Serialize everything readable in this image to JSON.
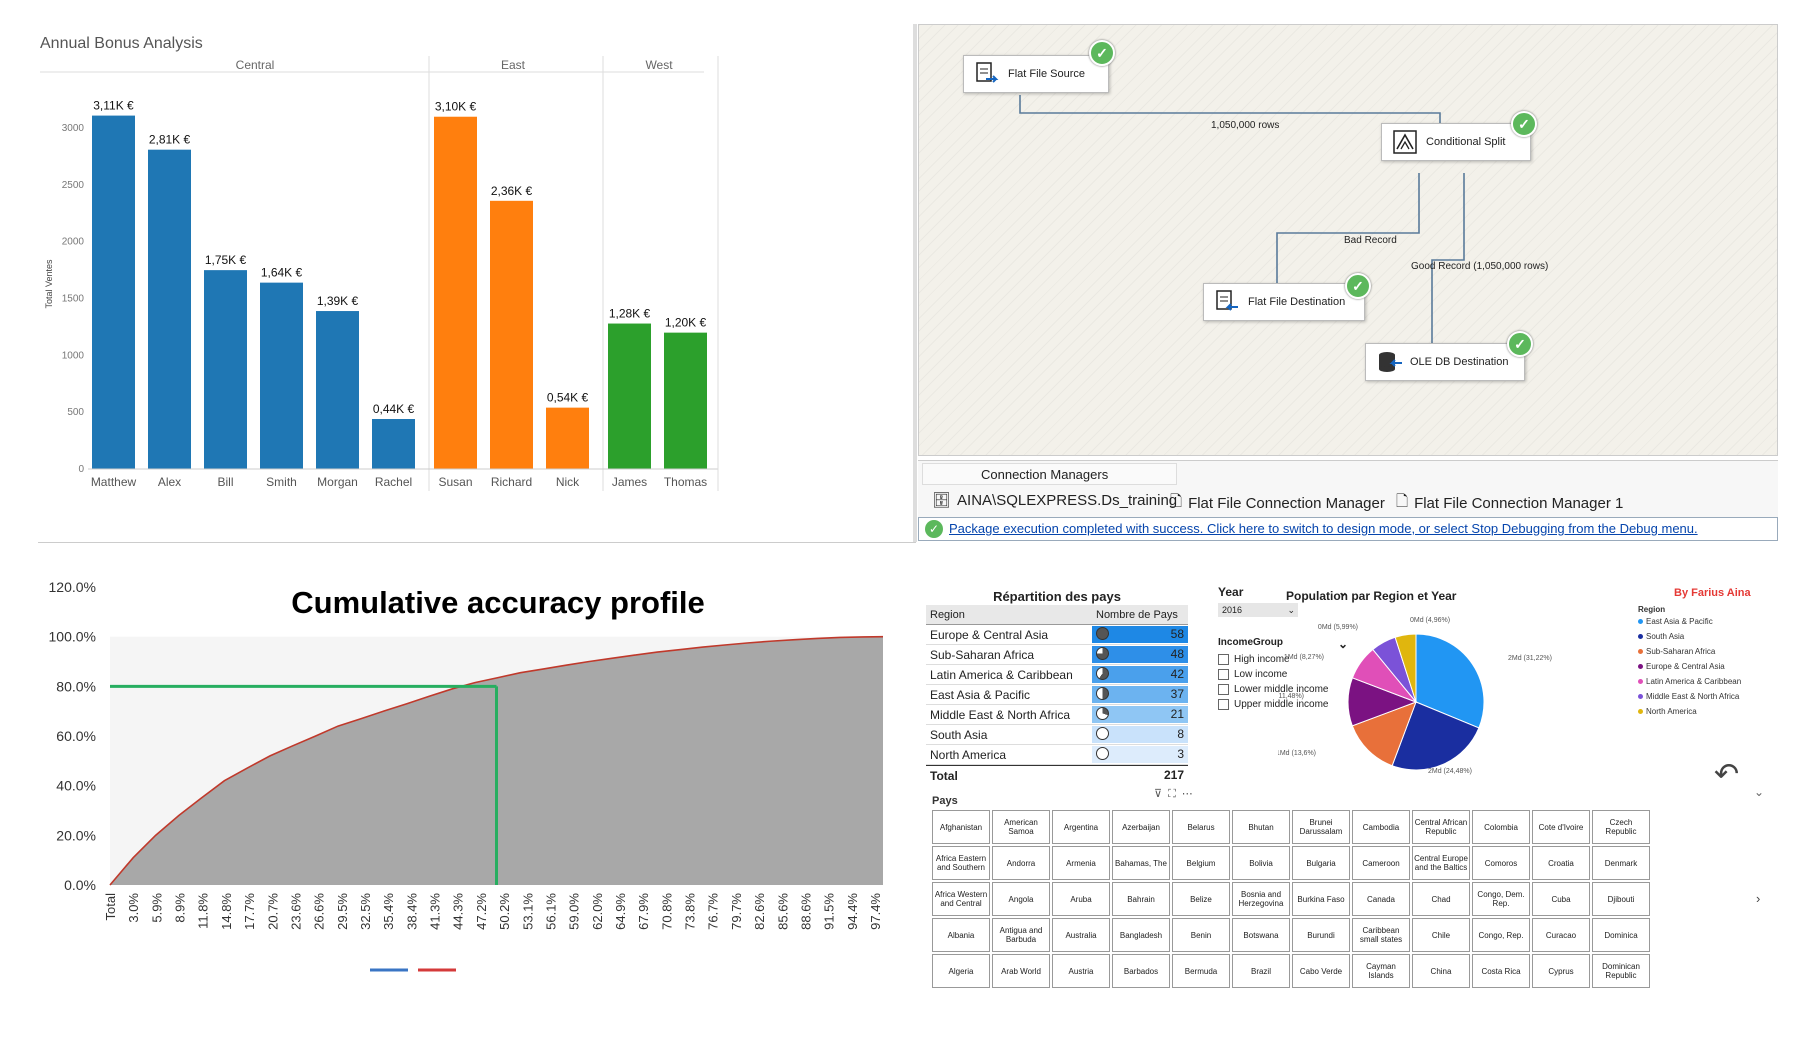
{
  "bonus": {
    "title": "Annual Bonus Analysis",
    "ylabel": "Total Ventes",
    "groups": [
      {
        "name": "Central",
        "color": "#1f77b4",
        "items": [
          {
            "name": "Matthew",
            "value": 3110,
            "label": "3,11K €"
          },
          {
            "name": "Alex",
            "value": 2810,
            "label": "2,81K €"
          },
          {
            "name": "Bill",
            "value": 1750,
            "label": "1,75K €"
          },
          {
            "name": "Smith",
            "value": 1640,
            "label": "1,64K €"
          },
          {
            "name": "Morgan",
            "value": 1390,
            "label": "1,39K €"
          },
          {
            "name": "Rachel",
            "value": 440,
            "label": "0,44K €"
          }
        ]
      },
      {
        "name": "East",
        "color": "#ff7f0e",
        "items": [
          {
            "name": "Susan",
            "value": 3100,
            "label": "3,10K €"
          },
          {
            "name": "Richard",
            "value": 2360,
            "label": "2,36K €"
          },
          {
            "name": "Nick",
            "value": 540,
            "label": "0,54K €"
          }
        ]
      },
      {
        "name": "West",
        "color": "#2ca02c",
        "items": [
          {
            "name": "James",
            "value": 1280,
            "label": "1,28K €"
          },
          {
            "name": "Thomas",
            "value": 1200,
            "label": "1,20K €"
          }
        ]
      }
    ],
    "yticks": [
      0,
      500,
      1000,
      1500,
      2000,
      2500,
      3000
    ],
    "ymax": 3300
  },
  "ssis": {
    "nodes": {
      "source": "Flat File Source",
      "split": "Conditional Split",
      "ffdest": "Flat File Destination",
      "oledest": "OLE DB Destination"
    },
    "edges": {
      "rows": "1,050,000 rows",
      "bad": "Bad Record",
      "good": "Good Record (1,050,000 rows)"
    },
    "conn_tab": "Connection Managers",
    "connections": [
      "AINA\\SQLEXPRESS.Ds_training",
      "Flat File Connection Manager",
      "Flat File Connection Manager 1"
    ],
    "status": "Package execution completed with success. Click here to switch to design mode, or select Stop Debugging from the Debug menu."
  },
  "cap": {
    "title": "Cumulative accuracy profile",
    "yticks": [
      "0.0%",
      "20.0%",
      "40.0%",
      "60.0%",
      "80.0%",
      "100.0%",
      "120.0%"
    ],
    "xticks": [
      "Total",
      "3.0%",
      "5.9%",
      "8.9%",
      "11.8%",
      "14.8%",
      "17.7%",
      "20.7%",
      "23.6%",
      "26.6%",
      "29.5%",
      "32.5%",
      "35.4%",
      "38.4%",
      "41.3%",
      "44.3%",
      "47.2%",
      "50.2%",
      "53.1%",
      "56.1%",
      "59.0%",
      "62.0%",
      "64.9%",
      "67.9%",
      "70.8%",
      "73.8%",
      "76.7%",
      "79.7%",
      "82.6%",
      "85.6%",
      "88.6%",
      "91.5%",
      "94.4%",
      "97.4%"
    ],
    "curve_x": [
      0,
      0.03,
      0.059,
      0.089,
      0.118,
      0.148,
      0.177,
      0.207,
      0.236,
      0.266,
      0.295,
      0.325,
      0.354,
      0.384,
      0.413,
      0.443,
      0.472,
      0.502,
      0.531,
      0.561,
      0.59,
      0.62,
      0.649,
      0.679,
      0.708,
      0.738,
      0.767,
      0.797,
      0.826,
      0.856,
      0.886,
      0.915,
      0.944,
      0.974,
      1.0
    ],
    "curve_y": [
      0,
      0.11,
      0.2,
      0.28,
      0.35,
      0.42,
      0.47,
      0.52,
      0.56,
      0.6,
      0.64,
      0.67,
      0.7,
      0.73,
      0.76,
      0.79,
      0.815,
      0.835,
      0.855,
      0.87,
      0.885,
      0.9,
      0.913,
      0.926,
      0.938,
      0.948,
      0.958,
      0.967,
      0.975,
      0.982,
      0.988,
      0.993,
      0.997,
      0.999,
      1.0
    ],
    "marker_x": 0.5,
    "marker_y": 0.8,
    "colors": {
      "area": "#a8a8a8",
      "curve": "#c0392b",
      "marker": "#27ae60",
      "legend1": "#3a75c4",
      "legend2": "#d43a3a"
    }
  },
  "pbi": {
    "table_title": "Répartition des pays",
    "col_region": "Region",
    "col_count": "Nombre de Pays",
    "rows": [
      {
        "region": "Europe & Central Asia",
        "count": "58"
      },
      {
        "region": "Sub-Saharan Africa",
        "count": "48"
      },
      {
        "region": "Latin America & Caribbean",
        "count": "42"
      },
      {
        "region": "East Asia & Pacific",
        "count": "37"
      },
      {
        "region": "Middle East & North Africa",
        "count": "21"
      },
      {
        "region": "South Asia",
        "count": "8"
      },
      {
        "region": "North America",
        "count": "3"
      }
    ],
    "total_label": "Total",
    "total": "217",
    "year_label": "Year",
    "year_value": "2016",
    "income_label": "IncomeGroup",
    "income_opts": [
      "High income",
      "Low income",
      "Lower middle income",
      "Upper middle income"
    ],
    "pie_title": "Population par Region et Year",
    "author": "By Farius Aina",
    "legend_title": "Region",
    "pie": [
      {
        "name": "East Asia & Pacific",
        "value": 31.22,
        "color": "#2196f3",
        "label": "2Md (31,22%)"
      },
      {
        "name": "South Asia",
        "value": 24.48,
        "color": "#1a2ea0",
        "label": "2Md (24,48%)"
      },
      {
        "name": "Sub-Saharan Africa",
        "value": 13.6,
        "color": "#e8703a",
        "label": "1Md (13,6%)"
      },
      {
        "name": "Europe & Central Asia",
        "value": 11.48,
        "color": "#7b1282",
        "label": "1Md (11,48%)"
      },
      {
        "name": "Latin America & Caribbean",
        "value": 8.27,
        "color": "#e04fb8",
        "label": "1Md (8,27%)"
      },
      {
        "name": "Middle East & North Africa",
        "value": 5.99,
        "color": "#7b52d8",
        "label": "0Md (5,99%)"
      },
      {
        "name": "North America",
        "value": 4.96,
        "color": "#e0b60e",
        "label": "0Md (4,96%)"
      }
    ],
    "pays_label": "Pays",
    "countries": [
      "Afghanistan",
      "American Samoa",
      "Argentina",
      "Azerbaijan",
      "Belarus",
      "Bhutan",
      "Brunei Darussalam",
      "Cambodia",
      "Central African Republic",
      "Colombia",
      "Cote d'Ivoire",
      "Czech Republic",
      "Africa Eastern and Southern",
      "Andorra",
      "Armenia",
      "Bahamas, The",
      "Belgium",
      "Bolivia",
      "Bulgaria",
      "Cameroon",
      "Central Europe and the Baltics",
      "Comoros",
      "Croatia",
      "Denmark",
      "Africa Western and Central",
      "Angola",
      "Aruba",
      "Bahrain",
      "Belize",
      "Bosnia and Herzegovina",
      "Burkina Faso",
      "Canada",
      "Chad",
      "Congo, Dem. Rep.",
      "Cuba",
      "Djibouti",
      "Albania",
      "Antigua and Barbuda",
      "Australia",
      "Bangladesh",
      "Benin",
      "Botswana",
      "Burundi",
      "Caribbean small states",
      "Chile",
      "Congo, Rep.",
      "Curacao",
      "Dominica",
      "Algeria",
      "Arab World",
      "Austria",
      "Barbados",
      "Bermuda",
      "Brazil",
      "Cabo Verde",
      "Cayman Islands",
      "China",
      "Costa Rica",
      "Cyprus",
      "Dominican Republic"
    ]
  }
}
